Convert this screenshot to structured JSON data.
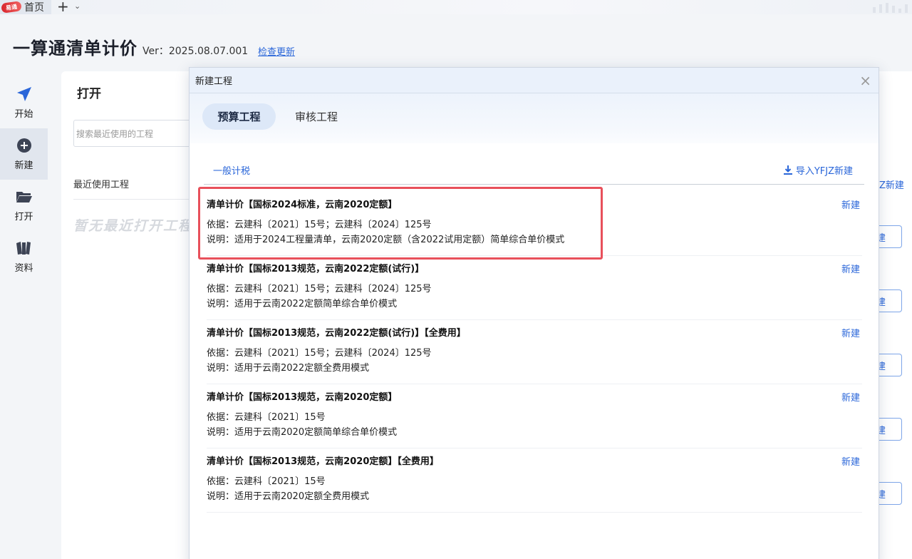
{
  "tabstrip": {
    "logo_text": "易通",
    "home_tab": "首页",
    "add_tab": "+",
    "menu_chevron": "⌄"
  },
  "header": {
    "app_title": "一算通清单计价",
    "version": "Ver：2025.08.07.001",
    "check_update": "检查更新"
  },
  "nav": {
    "items": [
      {
        "label": "开始",
        "icon": "send-arrow-icon",
        "active": false
      },
      {
        "label": "新建",
        "icon": "plus-circle-icon",
        "active": true
      },
      {
        "label": "打开",
        "icon": "folder-icon",
        "active": false
      },
      {
        "label": "资料",
        "icon": "book-icon",
        "active": false
      }
    ]
  },
  "background": {
    "open_title": "打开",
    "search_placeholder": "搜索最近使用的工程",
    "recent_label": "最近使用工程",
    "no_recent": "暂无最近打开工程",
    "import_label": "Z新建",
    "button_label": "建"
  },
  "dialog": {
    "title": "新建工程",
    "close": "×",
    "tabs": [
      {
        "label": "预算工程",
        "active": true
      },
      {
        "label": "审核工程",
        "active": false
      }
    ],
    "tax_tab": "一般计税",
    "import_link": "导入YFJZ新建",
    "templates": [
      {
        "title": "清单计价【国标2024标准，云南2020定额】",
        "basis": "依据：云建科〔2021〕15号；云建科〔2024〕125号",
        "desc": "说明：适用于2024工程量清单，云南2020定额（含2022试用定额）简单综合单价模式",
        "action": "新建",
        "highlighted": true
      },
      {
        "title": "清单计价【国标2013规范，云南2022定额(试行)】",
        "basis": "依据：云建科〔2021〕15号；云建科〔2024〕125号",
        "desc": "说明：适用于云南2022定额简单综合单价模式",
        "action": "新建",
        "highlighted": false
      },
      {
        "title": "清单计价【国标2013规范，云南2022定额(试行)】【全费用】",
        "basis": "依据：云建科〔2021〕15号；云建科〔2024〕125号",
        "desc": "说明：适用于云南2022定额全费用模式",
        "action": "新建",
        "highlighted": false
      },
      {
        "title": "清单计价【国标2013规范，云南2020定额】",
        "basis": "依据：云建科〔2021〕15号",
        "desc": "说明：适用于云南2020定额简单综合单价模式",
        "action": "新建",
        "highlighted": false
      },
      {
        "title": "清单计价【国标2013规范，云南2020定额】【全费用】",
        "basis": "依据：云建科〔2021〕15号",
        "desc": "说明：适用于云南2020定额全费用模式",
        "action": "新建",
        "highlighted": false
      }
    ]
  },
  "colors": {
    "accent": "#2a66d9",
    "highlight": "#e8505b",
    "active_tab_bg": "#dde8f8"
  }
}
